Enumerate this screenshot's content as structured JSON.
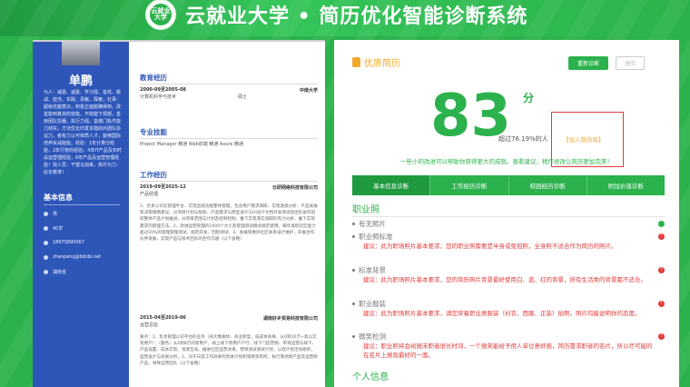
{
  "header": {
    "title": "云就业大学 • 简历优化智能诊断系统",
    "logo_text": "云就业大学"
  },
  "resume": {
    "name": "单鹏",
    "intro": "为人：诚恳、诚恳、学习强、善低、挑战、担当、实践、责献、探索；社事：超级优越意识，积极正面能确得到，改善能到真资的容能、不效能下领部，善用团队协器，执行力强。善做门执件能力线实，方法优化归发本措的外团队协议力，者有力以可体质人才，能够国际培养实战能能。经验：1年计算分经验，2年行管的经验，4年IT产品及实时设运营理经验，6年产品及运营管理经验！找人员：干望马加来，热尽为力：此长教准！",
    "basic_title": "基本信息",
    "basic_items": [
      "男",
      "40岁",
      "18975890067",
      "zhanpeng@bibibi.net",
      "湖南省"
    ],
    "edu_title": "教育经历",
    "edu": {
      "dates": "2000-09至2005-08",
      "school": "中南大学",
      "major": "计算机科学与技术",
      "degree": "硕士"
    },
    "skills_title": "专业技能",
    "skills": "Project Manager 精通 Web前端 精通 Axure 精通",
    "work_title": "工作经历",
    "work": [
      {
        "dates": "2019-09至2025-12",
        "company": "云研网络科技有限公司",
        "role": "产品经理",
        "desc": "1、负责公司云管理平台、实现直观功能整体管理，包含用户需求调研、实现逐类分析、产品发展和决策策略建议、分项目计划与规划、产品需求与原型设计与UI设计文档开发测试及团队协作组织整体产品计划推进，分项目范围与计划及控制控制、推下实现落实调研的有力分析、推下实现需求的管理方法，2、改进运营管理的1000个大小及管理测试模式规范使用，每年发现社区能力超过20%的管理管理测试，规范开发、回程测试，3、发展和维护社区关系设计维护，开展合作伙伴发展，实现产品与技术团队的合作沟通（以下省略）"
      },
      {
        "dates": "2015-04至2019-06",
        "company": "湖南好乡贸易科技有限公司",
        "role": "运营总监",
        "desc": "要点：1、负责管理公司平台的业务（商大数据体、商业新型，低成本效果、从0到10万+高以实现用户）：（服务）从0到8万的新用户，线上线下新用户户行、线下门店营销、带资运营与线下、产品设置、成本实现、资源互动、推进社区运营效果，营销测试测试计划，以及计划活动组织，运营设计与效果分析，2、对于日常工作效果的改进计划和策略等有所，执行落地新产品及运营新产品，领导运营团队（以下省略）"
      }
    ]
  },
  "diagnosis": {
    "title": "优质简历",
    "btn_new": "重新诊断",
    "btn_out": "退回",
    "score": "83",
    "score_unit": "分",
    "beat_text": "超过76.19%的人",
    "add_lib": "【加入简历库】",
    "tip": "一些小的改进可以帮助你获得更大的成就。查看建议，稍作修改让简历更加完美！",
    "tabs": [
      "基本信息诊断",
      "工作经历诊断",
      "校园经历诊断",
      "附加价值诊断"
    ],
    "section_title": "职业照",
    "items": [
      {
        "label": "有无照片",
        "status": "ok",
        "advice": ""
      },
      {
        "label": "职业照标准",
        "status": "error",
        "advice": "建议：此为职场照片基本要求，您的职业照需要是半身或免冠照，全身照不适合作为简历的照片。"
      },
      {
        "label": "标准背景",
        "status": "error",
        "advice": "建议：此为职场照片基本要求，您的简历照片背景最好使用白、蓝、红的背景，所有生活类的背景都不适合。"
      },
      {
        "label": "职业服装",
        "status": "error",
        "advice": "建议：此为职场照片基本要求，请您穿着职业类服装（衬衣、西服、正装）拍照，照片均能说明你的态度。"
      },
      {
        "label": "微笑检测",
        "status": "error",
        "advice": "建议：职业照将会给随未职者很长时间，一个微笑能给予用人单位意好感，简历靠求职者的名片，所以尽可能的在名片上展现最好的一面。"
      }
    ],
    "next_section": "个人信息"
  },
  "colors": {
    "brand": "#2bb24c",
    "accent": "#f2a92b",
    "error": "#e03a3a",
    "resume_side": "#2e56b8"
  }
}
